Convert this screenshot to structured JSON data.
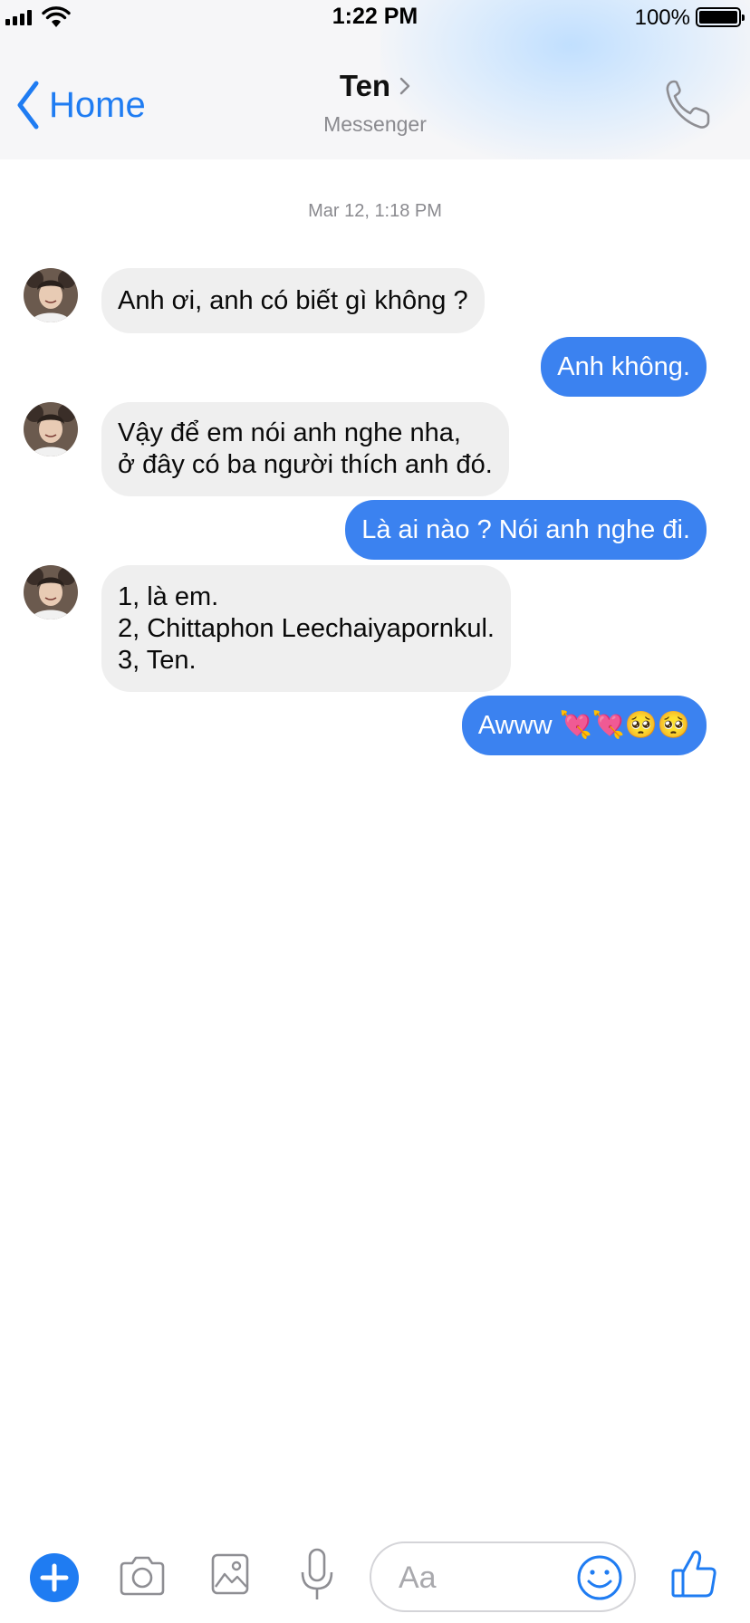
{
  "status_bar": {
    "time": "1:22 PM",
    "battery_percent": "100%"
  },
  "header": {
    "back_label": "Home",
    "contact_name": "Ten",
    "subtitle": "Messenger"
  },
  "chat": {
    "timestamp": "Mar 12, 1:18 PM",
    "messages": [
      {
        "direction": "in",
        "text": "Anh ơi, anh có biết gì không ?"
      },
      {
        "direction": "out",
        "text": "Anh không."
      },
      {
        "direction": "in",
        "text": "Vậy để em nói anh nghe nha,\nở đây có ba người thích anh đó."
      },
      {
        "direction": "out",
        "text": "Là ai nào ? Nói anh nghe đi."
      },
      {
        "direction": "in",
        "text": "1, là em.\n2, Chittaphon Leechaiyapornkul.\n3, Ten."
      },
      {
        "direction": "out",
        "text": "Awww 💘💘🥺🥺"
      }
    ]
  },
  "composer": {
    "placeholder": "Aa"
  },
  "colors": {
    "accent": "#1f7cf2",
    "outgoing_bubble": "#3b82f0",
    "incoming_bubble": "#efefef",
    "muted_text": "#8a8a8f"
  },
  "icons": {
    "back": "chevron-left-icon",
    "call": "phone-icon",
    "more": "plus-circle-icon",
    "camera": "camera-icon",
    "gallery": "image-icon",
    "voice": "microphone-icon",
    "emoji": "smiley-icon",
    "like": "thumbs-up-icon"
  }
}
